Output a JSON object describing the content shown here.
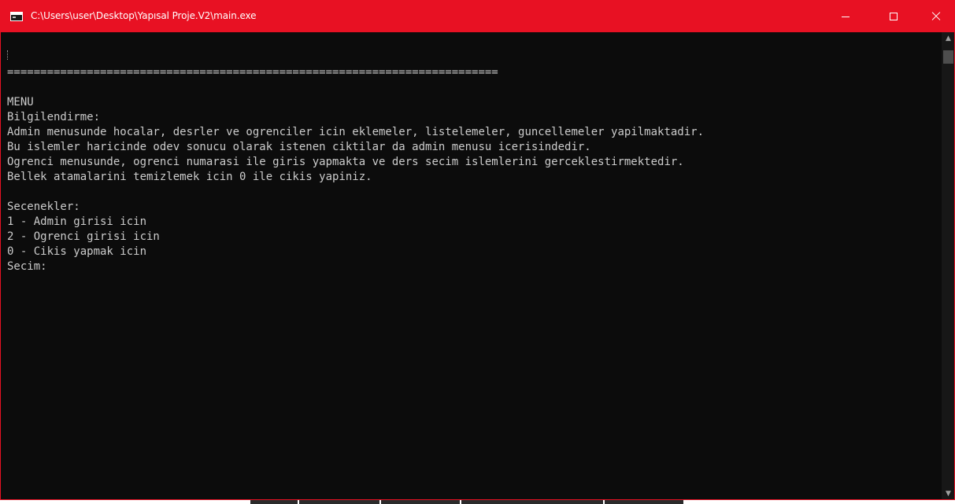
{
  "window": {
    "title": "C:\\Users\\user\\Desktop\\Yapısal Proje.V2\\main.exe",
    "accent_color": "#e81123",
    "icons": {
      "app": "console-app-icon",
      "minimize": "minimize-icon",
      "maximize": "maximize-icon",
      "close": "close-icon"
    }
  },
  "console": {
    "background": "#0c0c0c",
    "foreground": "#cccccc",
    "lines": [
      "",
      "",
      "==========================================================================",
      "",
      "MENU",
      "Bilgilendirme:",
      "Admin menusunde hocalar, desrler ve ogrenciler icin eklemeler, listelemeler, guncellemeler yapilmaktadir.",
      "Bu islemler haricinde odev sonucu olarak istenen ciktilar da admin menusu icerisindedir.",
      "Ogrenci menusunde, ogrenci numarasi ile giris yapmakta ve ders secim islemlerini gerceklestirmektedir.",
      "Bellek atamalarini temizlemek icin 0 ile cikis yapiniz.",
      "",
      "Secenekler:",
      "1 - Admin girisi icin",
      "2 - Ogrenci girisi icin",
      "0 - Cikis yapmak icin",
      "Secim:"
    ]
  },
  "scrollbar": {
    "up_icon": "▲",
    "down_icon": "▼"
  }
}
